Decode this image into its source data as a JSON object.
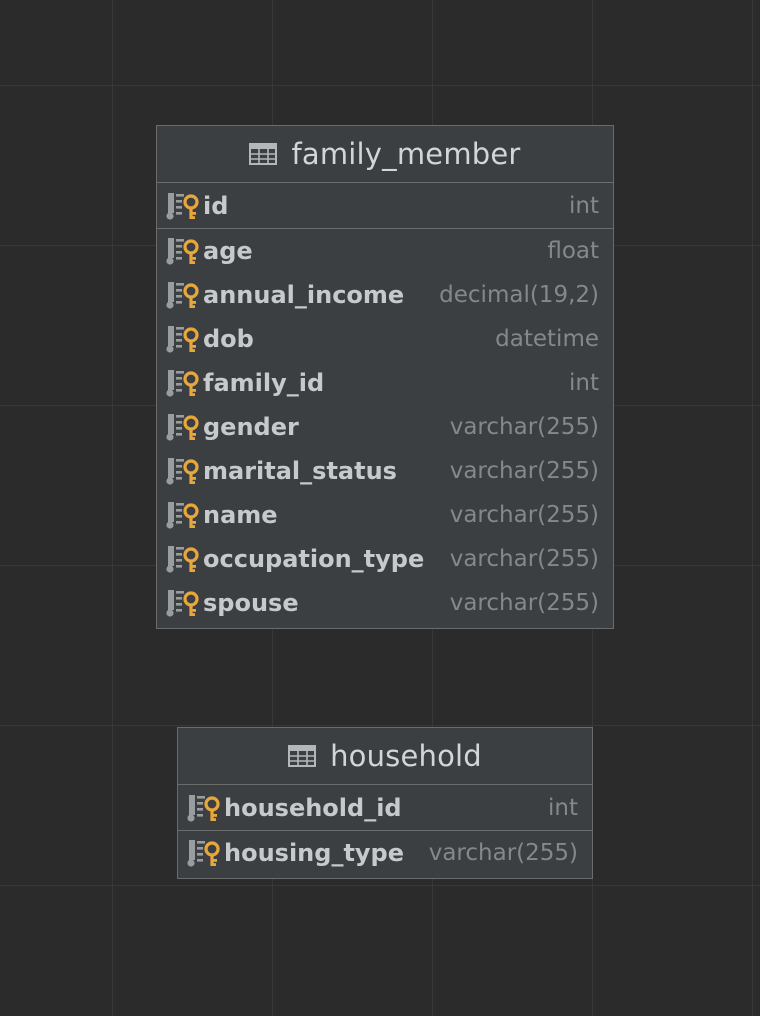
{
  "tables": [
    {
      "name": "family_member",
      "icon": "table-icon",
      "columns": [
        {
          "name": "id",
          "type": "int",
          "primary_key": true,
          "icon": "column-key-icon"
        },
        {
          "name": "age",
          "type": "float",
          "icon": "column-key-icon"
        },
        {
          "name": "annual_income",
          "type": "decimal(19,2)",
          "icon": "column-key-icon"
        },
        {
          "name": "dob",
          "type": "datetime",
          "icon": "column-key-icon"
        },
        {
          "name": "family_id",
          "type": "int",
          "icon": "column-key-icon"
        },
        {
          "name": "gender",
          "type": "varchar(255)",
          "icon": "column-key-icon"
        },
        {
          "name": "marital_status",
          "type": "varchar(255)",
          "icon": "column-key-icon"
        },
        {
          "name": "name",
          "type": "varchar(255)",
          "icon": "column-key-icon"
        },
        {
          "name": "occupation_type",
          "type": "varchar(255)",
          "icon": "column-key-icon"
        },
        {
          "name": "spouse",
          "type": "varchar(255)",
          "icon": "column-key-icon"
        }
      ]
    },
    {
      "name": "household",
      "icon": "table-icon",
      "columns": [
        {
          "name": "household_id",
          "type": "int",
          "primary_key": true,
          "icon": "column-key-icon"
        },
        {
          "name": "housing_type",
          "type": "varchar(255)",
          "icon": "column-key-icon"
        }
      ]
    }
  ],
  "colors": {
    "canvas": "#2b2b2b",
    "grid": "#383838",
    "card": "#3c3f41",
    "border": "#6b6b6b",
    "column_name": "#c6cacd",
    "column_type": "#85888b",
    "key_icon": "#e8a73c",
    "column_icon": "#9a9da0"
  }
}
